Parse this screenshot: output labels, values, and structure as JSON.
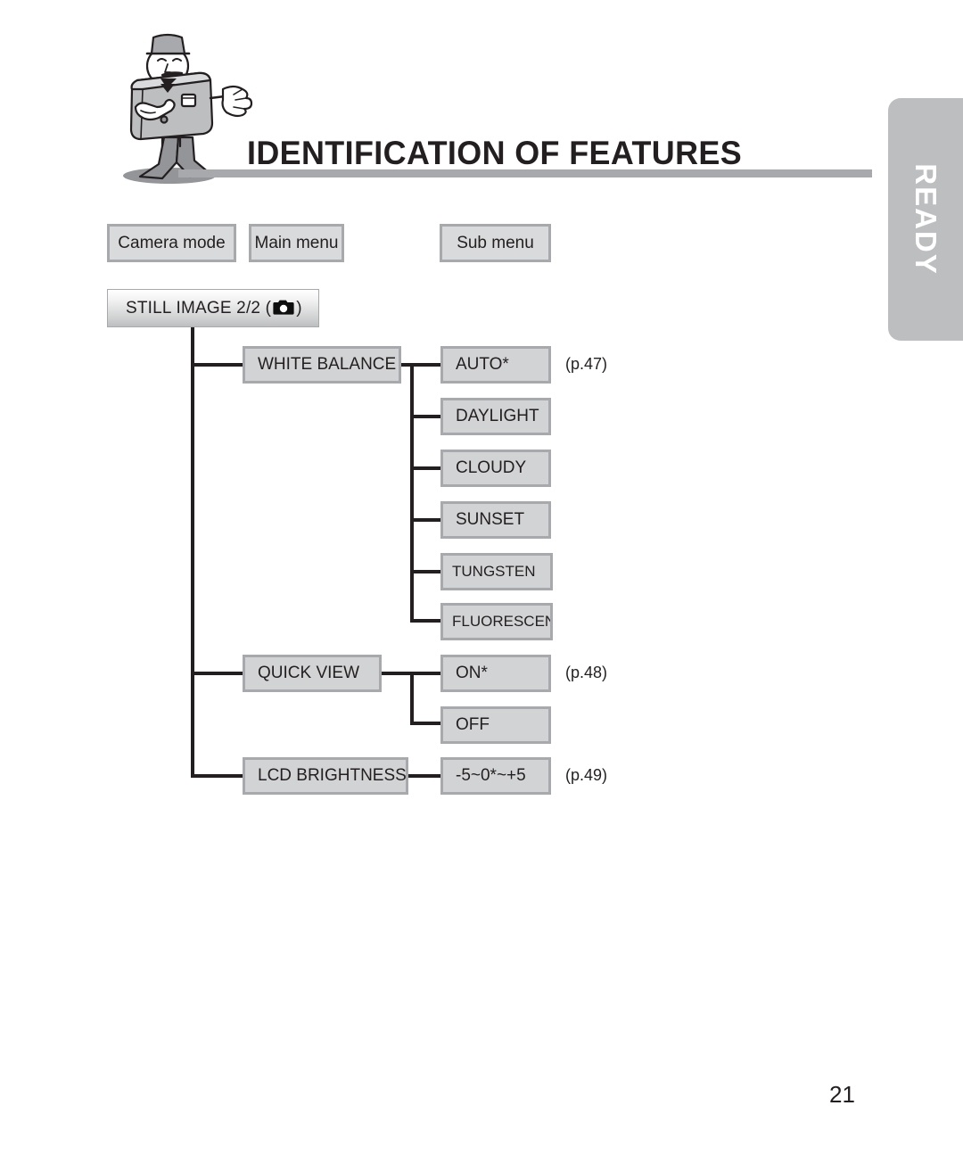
{
  "header": {
    "title": "IDENTIFICATION OF FEATURES",
    "mascot_icon": "camera-mascot-character"
  },
  "side_tab": {
    "label": "READY",
    "color": "#bcbec0"
  },
  "legend": {
    "camera_mode": "Camera mode",
    "main_menu": "Main menu",
    "sub_menu": "Sub menu"
  },
  "root": {
    "label_before": "STILL IMAGE 2/2 (",
    "icon": "still-camera-icon",
    "label_after": ")"
  },
  "menu": [
    {
      "label": "WHITE BALANCE",
      "page_ref": "(p.47)",
      "items": [
        {
          "label": "AUTO*"
        },
        {
          "label": "DAYLIGHT"
        },
        {
          "label": "CLOUDY"
        },
        {
          "label": "SUNSET"
        },
        {
          "label": "TUNGSTEN"
        },
        {
          "label": "FLUORESCENT"
        }
      ]
    },
    {
      "label": "QUICK VIEW",
      "page_ref": "(p.48)",
      "items": [
        {
          "label": "ON*"
        },
        {
          "label": "OFF"
        }
      ]
    },
    {
      "label": "LCD BRIGHTNESS",
      "page_ref": "(p.49)",
      "items": [
        {
          "label": "-5~0*~+5"
        }
      ]
    }
  ],
  "footer": {
    "page_number": "21"
  }
}
